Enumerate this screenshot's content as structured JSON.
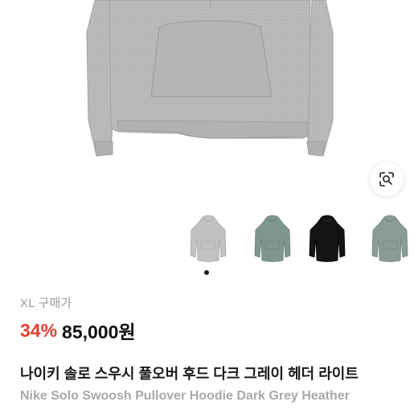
{
  "product": {
    "images": [
      {
        "variant": "light-grey-hoodie",
        "color": "#c2c2c2"
      },
      {
        "variant": "sage-grey-hoodie",
        "color": "#7f968e"
      },
      {
        "variant": "black-hoodie",
        "color": "#141414"
      },
      {
        "variant": "sage-grey-hoodie-2",
        "color": "#8a9c95"
      }
    ],
    "active_image_index": 0,
    "lens_icon": "lens-search-icon"
  },
  "purchase": {
    "size_label": "XL 구매가",
    "discount": "34%",
    "price": "85,000원"
  },
  "title": {
    "korean": "나이키 솔로 스우시 풀오버 후드 다크 그레이 헤더 라이트",
    "english": "Nike Solo Swoosh Pullover Hoodie Dark Grey Heather"
  },
  "colors": {
    "discount": "#e5402f",
    "hero_hoodie": "#b9b9b9"
  }
}
